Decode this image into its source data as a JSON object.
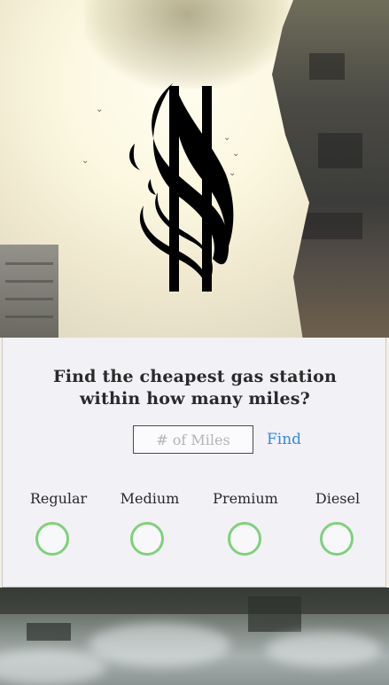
{
  "hero": {
    "logo_icon": "flame-dollar-icon"
  },
  "form": {
    "question_line1": "Find the cheapest gas station",
    "question_line2": "within how many miles?",
    "miles_placeholder": "# of Miles",
    "miles_value": "",
    "find_label": "Find",
    "accent_color": "#2f8be6",
    "radio_color": "#7fd17b",
    "fuel_types": [
      {
        "label": "Regular",
        "selected": false
      },
      {
        "label": "Medium",
        "selected": false
      },
      {
        "label": "Premium",
        "selected": false
      },
      {
        "label": "Diesel",
        "selected": false
      }
    ]
  }
}
